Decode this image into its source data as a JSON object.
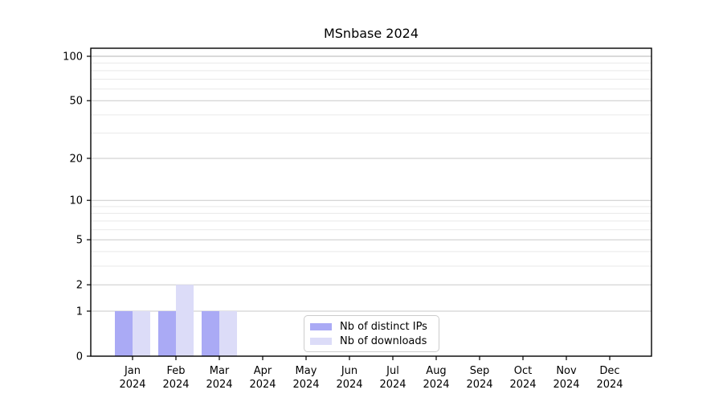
{
  "title": "MSnbase 2024",
  "legend": {
    "items": [
      {
        "label": "Nb of distinct IPs",
        "color": "#aaaaf5"
      },
      {
        "label": "Nb of downloads",
        "color": "#dcdcf8"
      }
    ]
  },
  "chart_data": {
    "type": "bar",
    "title": "MSnbase 2024",
    "categories": [
      "Jan",
      "Feb",
      "Mar",
      "Apr",
      "May",
      "Jun",
      "Jul",
      "Aug",
      "Sep",
      "Oct",
      "Nov",
      "Dec"
    ],
    "x_year_label": "2024",
    "series": [
      {
        "name": "Nb of distinct IPs",
        "color": "#aaaaf5",
        "values": [
          1,
          1,
          1,
          0,
          0,
          0,
          0,
          0,
          0,
          0,
          0,
          0
        ]
      },
      {
        "name": "Nb of downloads",
        "color": "#dcdcf8",
        "values": [
          1,
          2,
          1,
          0,
          0,
          0,
          0,
          0,
          0,
          0,
          0,
          0
        ]
      }
    ],
    "xlabel": "",
    "ylabel": "",
    "y_scale": "log1p",
    "y_ticks": [
      0,
      1,
      2,
      5,
      10,
      20,
      50,
      100
    ],
    "y_minor_ticks": [
      3,
      4,
      6,
      7,
      8,
      9,
      30,
      40,
      60,
      70,
      80,
      90
    ],
    "ylim": [
      0,
      113
    ],
    "grid": true,
    "legend_position": "lower center",
    "colors": {
      "major_grid": "#c9c9c9",
      "top_grid": "#b3b3b3",
      "minor_grid": "#e9e9e9",
      "axis": "#000000",
      "text": "#000000"
    }
  }
}
